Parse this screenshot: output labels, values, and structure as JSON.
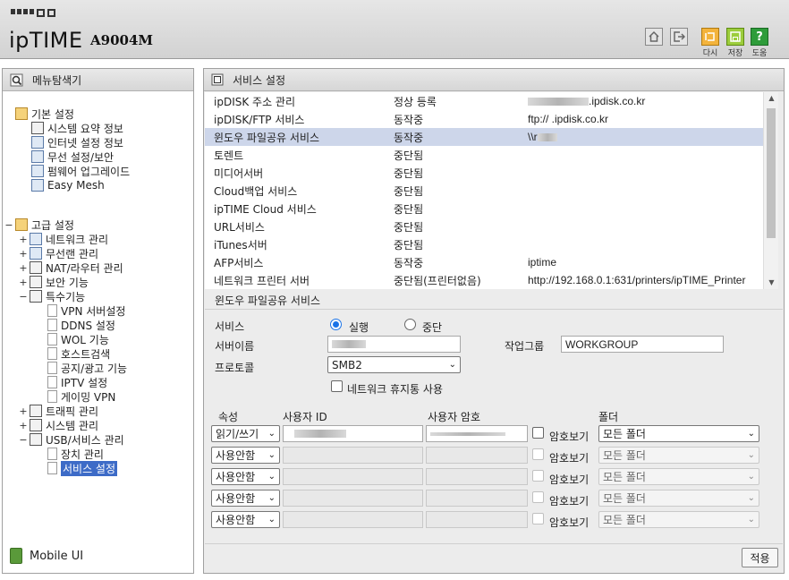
{
  "header": {
    "brand": "ipTIME",
    "model": "A9004M",
    "buttons": [
      {
        "icon": "home-icon",
        "label": ""
      },
      {
        "icon": "logout-icon",
        "label": ""
      },
      {
        "icon": "refresh-icon",
        "label": "다시"
      },
      {
        "icon": "save-icon",
        "label": "저장"
      },
      {
        "icon": "help-icon",
        "label": "도움"
      }
    ]
  },
  "sidebar": {
    "title": "메뉴탐색기",
    "basic": {
      "label": "기본 설정",
      "items": [
        "시스템 요약 정보",
        "인터넷 설정 정보",
        "무선 설정/보안",
        "펌웨어 업그레이드",
        "Easy Mesh"
      ]
    },
    "advanced": {
      "label": "고급 설정",
      "items": [
        {
          "label": "네트워크 관리",
          "toggle": "+"
        },
        {
          "label": "무선랜 관리",
          "toggle": "+"
        },
        {
          "label": "NAT/라우터 관리",
          "toggle": "+"
        },
        {
          "label": "보안 기능",
          "toggle": "+"
        },
        {
          "label": "특수기능",
          "toggle": "−"
        }
      ],
      "special": [
        "VPN 서버설정",
        "DDNS 설정",
        "WOL 기능",
        "호스트검색",
        "공지/광고 기능",
        "IPTV 설정",
        "게이밍 VPN"
      ],
      "more": [
        {
          "label": "트래픽 관리",
          "toggle": "+"
        },
        {
          "label": "시스템 관리",
          "toggle": "+"
        },
        {
          "label": "USB/서비스 관리",
          "toggle": "−"
        }
      ],
      "usb": [
        "장치 관리",
        "서비스 설정"
      ]
    },
    "mobile": "Mobile UI"
  },
  "main": {
    "title": "서비스 설정",
    "services": [
      {
        "name": "ipDISK 주소 관리",
        "status": "정상 등록",
        "info": ".ipdisk.co.kr"
      },
      {
        "name": "ipDISK/FTP 서비스",
        "status": "동작중",
        "info": "ftp:// .ipdisk.co.kr"
      },
      {
        "name": "윈도우 파일공유 서비스",
        "status": "동작중",
        "info": "\\\\r"
      },
      {
        "name": "토렌트",
        "status": "중단됨",
        "info": ""
      },
      {
        "name": "미디어서버",
        "status": "중단됨",
        "info": ""
      },
      {
        "name": "Cloud백업 서비스",
        "status": "중단됨",
        "info": ""
      },
      {
        "name": "ipTIME Cloud 서비스",
        "status": "중단됨",
        "info": ""
      },
      {
        "name": "URL서비스",
        "status": "중단됨",
        "info": ""
      },
      {
        "name": "iTunes서버",
        "status": "중단됨",
        "info": ""
      },
      {
        "name": "AFP서비스",
        "status": "동작중",
        "info": "iptime"
      },
      {
        "name": "네트워크 프린터 서버",
        "status": "중단됨(프린터없음)",
        "info": "http://192.168.0.1:631/printers/ipTIME_Printer"
      }
    ],
    "detail": {
      "title": "윈도우 파일공유 서비스",
      "service_label": "서비스",
      "run_label": "실행",
      "stop_label": "중단",
      "server_name_label": "서버이름",
      "server_name_value": "",
      "workgroup_label": "작업그룹",
      "workgroup_value": "WORKGROUP",
      "protocol_label": "프로토콜",
      "protocol_value": "SMB2",
      "recycle_label": "네트워크 휴지통 사용",
      "col_attr": "속성",
      "col_user": "사용자 ID",
      "col_pass": "사용자 암호",
      "col_folder": "폴더",
      "show_pass_label": "암호보기",
      "users": [
        {
          "attr": "읽기/쓰기",
          "folder": "모든 폴더",
          "enabled": true
        },
        {
          "attr": "사용안함",
          "folder": "모든 폴더",
          "enabled": false
        },
        {
          "attr": "사용안함",
          "folder": "모든 폴더",
          "enabled": false
        },
        {
          "attr": "사용안함",
          "folder": "모든 폴더",
          "enabled": false
        },
        {
          "attr": "사용안함",
          "folder": "모든 폴더",
          "enabled": false
        }
      ],
      "apply_label": "적용"
    }
  }
}
